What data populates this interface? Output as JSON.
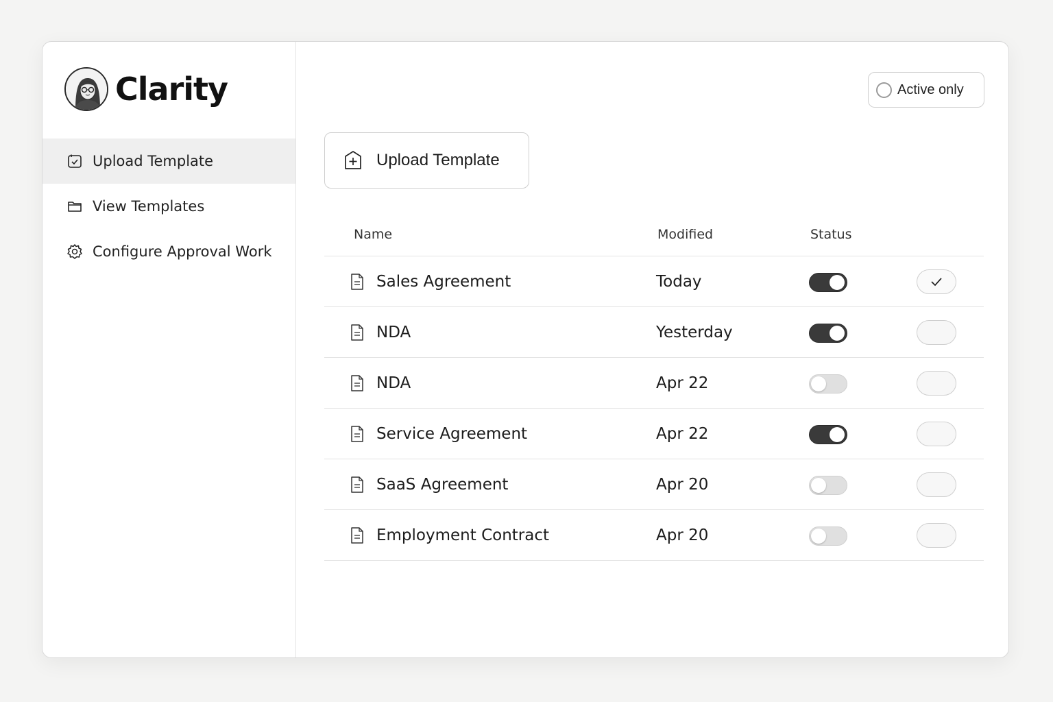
{
  "app": {
    "name": "Clarity"
  },
  "sidebar": {
    "items": [
      {
        "label": "Upload Template",
        "icon": "checkbox-doc-icon",
        "active": true
      },
      {
        "label": "View Templates",
        "icon": "folder-icon",
        "active": false
      },
      {
        "label": "Configure Approval Work",
        "icon": "gear-icon",
        "active": false
      }
    ]
  },
  "toolbar": {
    "filter_label": "Active only",
    "upload_label": "Upload Template"
  },
  "table": {
    "columns": {
      "name": "Name",
      "modified": "Modified",
      "status": "Status"
    },
    "rows": [
      {
        "name": "Sales Agreement",
        "modified": "Today",
        "active": true,
        "checked": true
      },
      {
        "name": "NDA",
        "modified": "Yesterday",
        "active": true,
        "checked": false
      },
      {
        "name": "NDA",
        "modified": "Apr 22",
        "active": false,
        "checked": false
      },
      {
        "name": "Service Agreement",
        "modified": "Apr 22",
        "active": true,
        "checked": false
      },
      {
        "name": "SaaS Agreement",
        "modified": "Apr 20",
        "active": false,
        "checked": false
      },
      {
        "name": "Employment Contract",
        "modified": "Apr 20",
        "active": false,
        "checked": false
      }
    ]
  },
  "colors": {
    "toggle_on": "#3a3a3a",
    "toggle_off": "#e0e0e0",
    "active_nav_bg": "#efefef"
  }
}
